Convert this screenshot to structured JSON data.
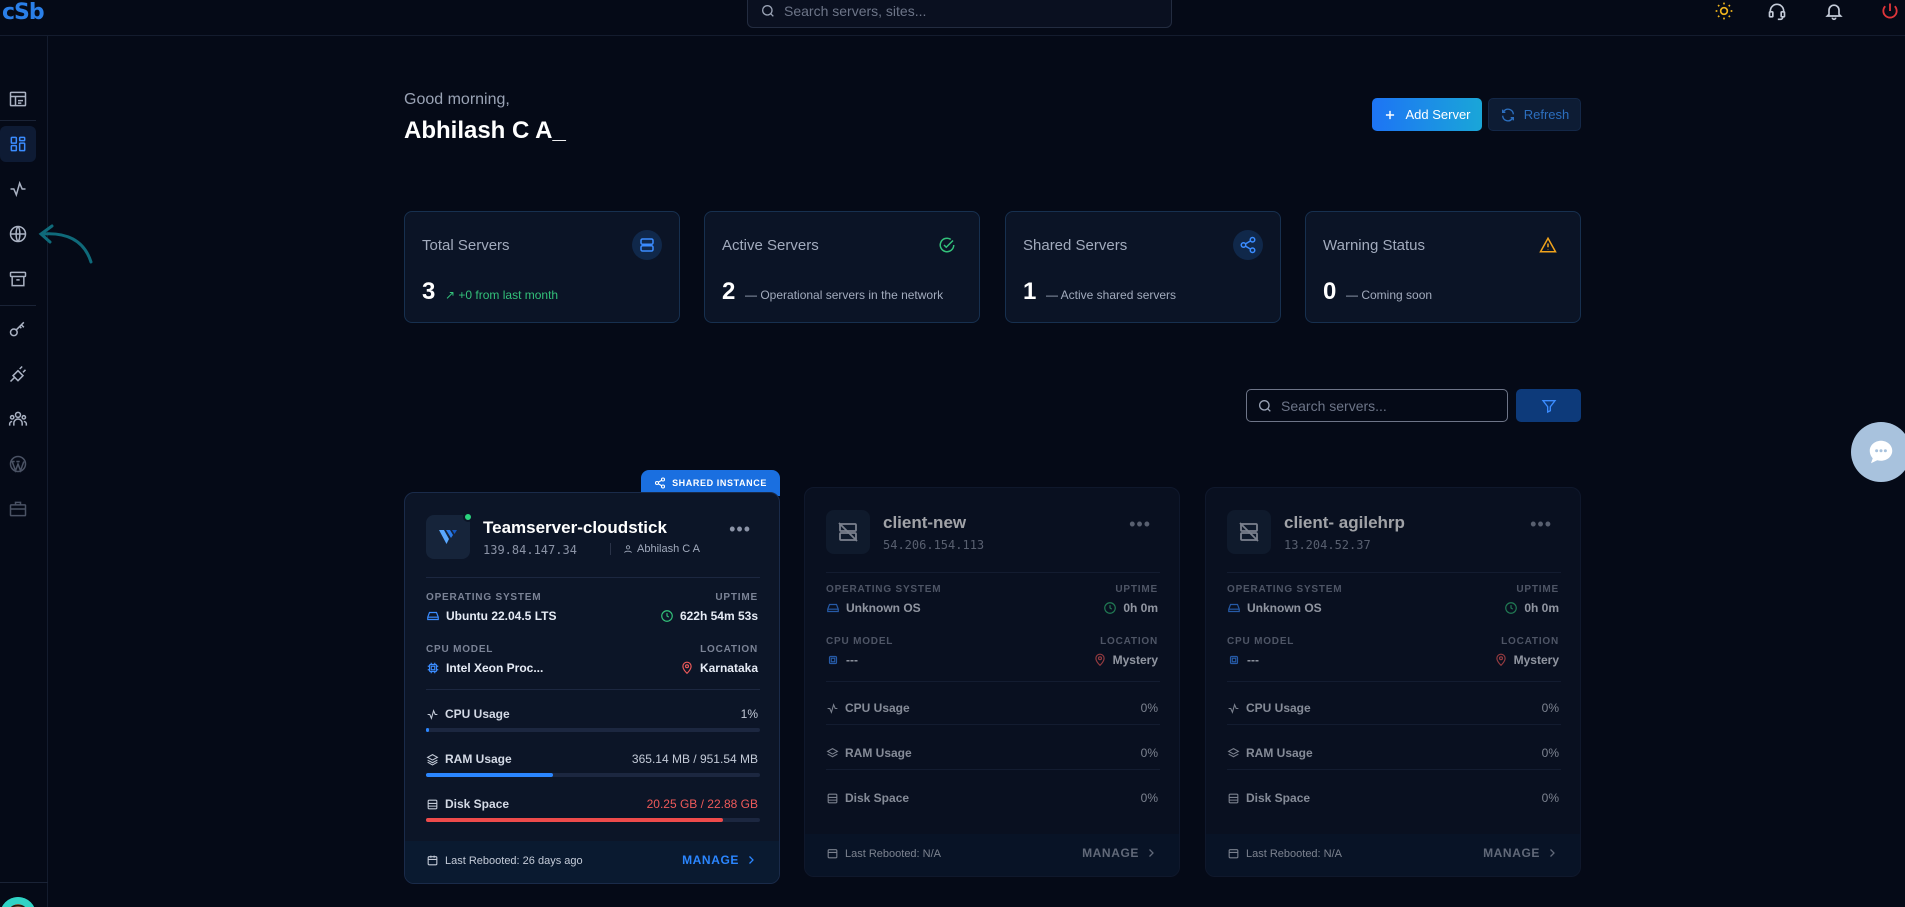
{
  "app": {
    "logo": "cSb"
  },
  "topbar": {
    "search_placeholder": "Search servers, sites...",
    "icons": [
      "theme-sun-icon",
      "support-headset-icon",
      "notifications-bell-icon",
      "power-icon"
    ]
  },
  "sidebar": {
    "items": [
      {
        "name": "reports",
        "icon": "report-icon"
      },
      {
        "name": "dashboard",
        "icon": "grid-icon",
        "active": true
      },
      {
        "name": "activity",
        "icon": "activity-icon"
      },
      {
        "name": "sites",
        "icon": "globe-icon"
      },
      {
        "name": "archive",
        "icon": "archive-icon"
      },
      {
        "name": "keys",
        "icon": "key-icon"
      },
      {
        "name": "integrations",
        "icon": "plug-icon"
      },
      {
        "name": "team",
        "icon": "users-icon"
      },
      {
        "name": "wordpress",
        "icon": "wordpress-icon"
      },
      {
        "name": "services",
        "icon": "briefcase-icon"
      }
    ]
  },
  "greeting": {
    "sub": "Good morning,",
    "name": "Abhilash C A_"
  },
  "actions": {
    "add_label": "Add Server",
    "refresh_label": "Refresh"
  },
  "stats": [
    {
      "title": "Total Servers",
      "value": "3",
      "note": "+0 from last month",
      "note_color": "#33c17a",
      "icon": "server-stack-icon",
      "icon_color": "#3b8cff"
    },
    {
      "title": "Active Servers",
      "value": "2",
      "note": "Operational servers in the network",
      "icon": "check-circle-icon",
      "icon_color": "#33c17a"
    },
    {
      "title": "Shared Servers",
      "value": "1",
      "note": "Active shared servers",
      "icon": "share-icon",
      "icon_color": "#3b8cff"
    },
    {
      "title": "Warning Status",
      "value": "0",
      "note": "Coming soon",
      "icon": "warning-icon",
      "icon_color": "#f0a31c"
    }
  ],
  "filter": {
    "search_placeholder": "Search servers..."
  },
  "shared_tag": "SHARED INSTANCE",
  "labels": {
    "os": "OPERATING SYSTEM",
    "uptime": "UPTIME",
    "cpu_model": "CPU MODEL",
    "location": "LOCATION",
    "cpu_usage": "CPU Usage",
    "ram_usage": "RAM Usage",
    "disk_space": "Disk Space",
    "manage": "MANAGE"
  },
  "servers": [
    {
      "name": "Teamserver-cloudstick",
      "ip": "139.84.147.34",
      "owner": "Abhilash C A",
      "os": "Ubuntu 22.04.5 LTS",
      "uptime": "622h 54m 53s",
      "cpu_model": "Intel Xeon Proc...",
      "location": "Karnataka",
      "cpu": "1%",
      "cpu_fraction": 0.01,
      "ram": "365.14 MB / 951.54 MB",
      "ram_fraction": 0.38,
      "disk": "20.25 GB / 22.88 GB",
      "disk_fraction": 0.89,
      "last_rebooted": "Last Rebooted: 26 days ago",
      "online": true
    },
    {
      "name": "client-new",
      "ip": "54.206.154.113",
      "owner": "",
      "os": "Unknown OS",
      "uptime": "0h 0m",
      "cpu_model": "---",
      "location": "Mystery",
      "cpu": "0%",
      "cpu_fraction": 0,
      "ram": "0%",
      "ram_fraction": 0,
      "disk": "0%",
      "disk_fraction": 0,
      "last_rebooted": "Last Rebooted: N/A",
      "online": false
    },
    {
      "name": "client- agilehrp",
      "ip": "13.204.52.37",
      "owner": "",
      "os": "Unknown OS",
      "uptime": "0h 0m",
      "cpu_model": "---",
      "location": "Mystery",
      "cpu": "0%",
      "cpu_fraction": 0,
      "ram": "0%",
      "ram_fraction": 0,
      "disk": "0%",
      "disk_fraction": 0,
      "last_rebooted": "Last Rebooted: N/A",
      "online": false
    }
  ]
}
